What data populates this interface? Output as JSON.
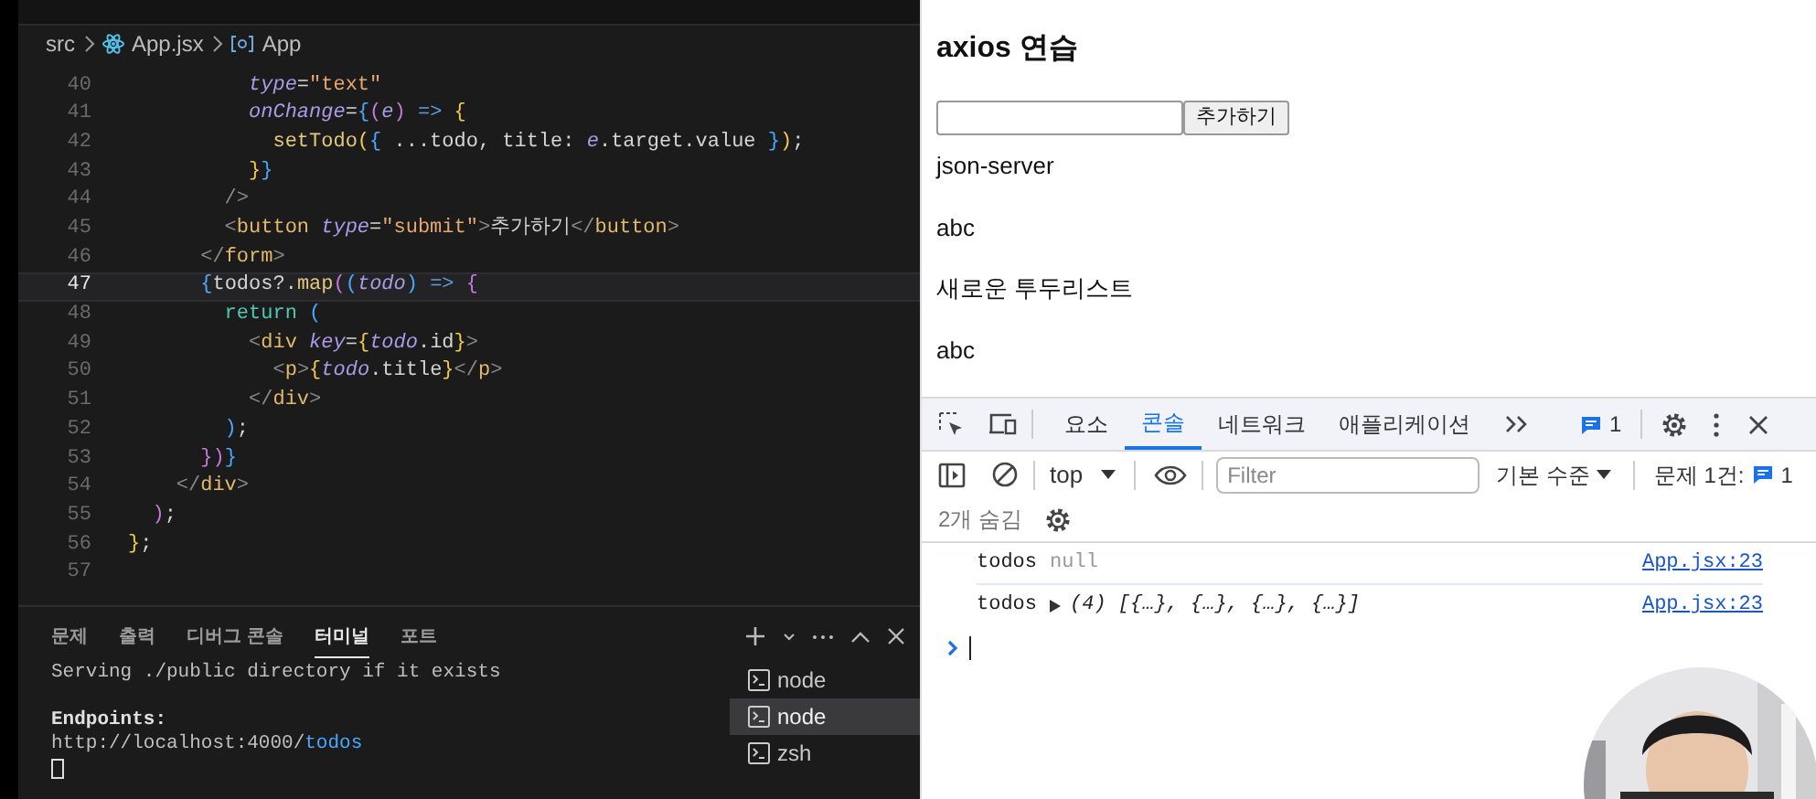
{
  "editor": {
    "breadcrumb": [
      "src",
      "App.jsx",
      "App"
    ],
    "lines": [
      {
        "num": "40",
        "current": false,
        "tokens": [
          {
            "text": "          type",
            "kind": "attr"
          },
          {
            "text": "=",
            "kind": "plain"
          },
          {
            "text": "\"text\"",
            "kind": "str"
          }
        ]
      },
      {
        "num": "41",
        "current": false,
        "tokens": [
          {
            "text": "          onChange",
            "kind": "attr"
          },
          {
            "text": "=",
            "kind": "plain"
          },
          {
            "text": "{",
            "kind": "b3"
          },
          {
            "text": "(",
            "kind": "b2"
          },
          {
            "text": "e",
            "kind": "param"
          },
          {
            "text": ")",
            "kind": "b2"
          },
          {
            "text": " => ",
            "kind": "kw"
          },
          {
            "text": "{",
            "kind": "b1"
          }
        ]
      },
      {
        "num": "42",
        "current": false,
        "tokens": [
          {
            "text": "            setTodo",
            "kind": "fn"
          },
          {
            "text": "(",
            "kind": "b1"
          },
          {
            "text": "{",
            "kind": "b3"
          },
          {
            "text": " ...todo, title: ",
            "kind": "plain"
          },
          {
            "text": "e",
            "kind": "param"
          },
          {
            "text": ".target.value ",
            "kind": "plain"
          },
          {
            "text": "}",
            "kind": "b3"
          },
          {
            "text": ")",
            "kind": "b1"
          },
          {
            "text": ";",
            "kind": "plain"
          }
        ]
      },
      {
        "num": "43",
        "current": false,
        "tokens": [
          {
            "text": "          }",
            "kind": "b1"
          },
          {
            "text": "}",
            "kind": "b3"
          }
        ]
      },
      {
        "num": "44",
        "current": false,
        "tokens": [
          {
            "text": "        />",
            "kind": "tagp"
          }
        ]
      },
      {
        "num": "45",
        "current": false,
        "tokens": [
          {
            "text": "        <",
            "kind": "tagp"
          },
          {
            "text": "button",
            "kind": "tag"
          },
          {
            "text": " type",
            "kind": "attr"
          },
          {
            "text": "=",
            "kind": "plain"
          },
          {
            "text": "\"submit\"",
            "kind": "str"
          },
          {
            "text": ">",
            "kind": "tagp"
          },
          {
            "text": "추가하기",
            "kind": "plain"
          },
          {
            "text": "</",
            "kind": "tagp"
          },
          {
            "text": "button",
            "kind": "tag"
          },
          {
            "text": ">",
            "kind": "tagp"
          }
        ]
      },
      {
        "num": "46",
        "current": false,
        "tokens": [
          {
            "text": "      </",
            "kind": "tagp"
          },
          {
            "text": "form",
            "kind": "tag"
          },
          {
            "text": ">",
            "kind": "tagp"
          }
        ]
      },
      {
        "num": "47",
        "current": true,
        "tokens": [
          {
            "text": "      {",
            "kind": "b3"
          },
          {
            "text": "todos?.",
            "kind": "plain"
          },
          {
            "text": "map",
            "kind": "fn"
          },
          {
            "text": "(",
            "kind": "b2"
          },
          {
            "text": "(",
            "kind": "b3"
          },
          {
            "text": "todo",
            "kind": "param"
          },
          {
            "text": ")",
            "kind": "b3"
          },
          {
            "text": " => ",
            "kind": "kw"
          },
          {
            "text": "{",
            "kind": "b2"
          }
        ]
      },
      {
        "num": "48",
        "current": false,
        "tokens": [
          {
            "text": "        return",
            "kind": "kw2"
          },
          {
            "text": " (",
            "kind": "b3"
          }
        ]
      },
      {
        "num": "49",
        "current": false,
        "tokens": [
          {
            "text": "          <",
            "kind": "tagp"
          },
          {
            "text": "div",
            "kind": "tag"
          },
          {
            "text": " key",
            "kind": "attr"
          },
          {
            "text": "=",
            "kind": "plain"
          },
          {
            "text": "{",
            "kind": "b1"
          },
          {
            "text": "todo",
            "kind": "param"
          },
          {
            "text": ".id",
            "kind": "plain"
          },
          {
            "text": "}",
            "kind": "b1"
          },
          {
            "text": ">",
            "kind": "tagp"
          }
        ]
      },
      {
        "num": "50",
        "current": false,
        "tokens": [
          {
            "text": "            <",
            "kind": "tagp"
          },
          {
            "text": "p",
            "kind": "tag"
          },
          {
            "text": ">",
            "kind": "tagp"
          },
          {
            "text": "{",
            "kind": "b1"
          },
          {
            "text": "todo",
            "kind": "param"
          },
          {
            "text": ".title",
            "kind": "plain"
          },
          {
            "text": "}",
            "kind": "b1"
          },
          {
            "text": "</",
            "kind": "tagp"
          },
          {
            "text": "p",
            "kind": "tag"
          },
          {
            "text": ">",
            "kind": "tagp"
          }
        ]
      },
      {
        "num": "51",
        "current": false,
        "tokens": [
          {
            "text": "          </",
            "kind": "tagp"
          },
          {
            "text": "div",
            "kind": "tag"
          },
          {
            "text": ">",
            "kind": "tagp"
          }
        ]
      },
      {
        "num": "52",
        "current": false,
        "tokens": [
          {
            "text": "        )",
            "kind": "b3"
          },
          {
            "text": ";",
            "kind": "plain"
          }
        ]
      },
      {
        "num": "53",
        "current": false,
        "tokens": [
          {
            "text": "      }",
            "kind": "b2"
          },
          {
            "text": ")",
            "kind": "b2"
          },
          {
            "text": "}",
            "kind": "b3"
          }
        ]
      },
      {
        "num": "54",
        "current": false,
        "tokens": [
          {
            "text": "    </",
            "kind": "tagp"
          },
          {
            "text": "div",
            "kind": "tag"
          },
          {
            "text": ">",
            "kind": "tagp"
          }
        ]
      },
      {
        "num": "55",
        "current": false,
        "tokens": [
          {
            "text": "  )",
            "kind": "b2"
          },
          {
            "text": ";",
            "kind": "plain"
          }
        ]
      },
      {
        "num": "56",
        "current": false,
        "tokens": [
          {
            "text": "}",
            "kind": "b1"
          },
          {
            "text": ";",
            "kind": "plain"
          }
        ]
      },
      {
        "num": "57",
        "current": false
      }
    ]
  },
  "panel": {
    "tabs": [
      {
        "label": "문제",
        "selected": false
      },
      {
        "label": "출력",
        "selected": false
      },
      {
        "label": "디버그 콘솔",
        "selected": false
      },
      {
        "label": "터미널",
        "selected": true
      },
      {
        "label": "포트",
        "selected": false
      }
    ],
    "terminal_lines": [
      [
        {
          "text": "Serving ./public directory if it exists",
          "kind": "plain"
        }
      ],
      [
        {
          "text": "Endpoints:",
          "kind": "bold"
        }
      ],
      [
        {
          "text": "http://localhost:4000/",
          "kind": "plain"
        },
        {
          "text": "todos",
          "kind": "link"
        }
      ]
    ],
    "terminals": [
      {
        "label": "node",
        "selected": false
      },
      {
        "label": "node",
        "selected": true
      },
      {
        "label": "zsh",
        "selected": false
      }
    ]
  },
  "browser": {
    "heading": "axios 연습",
    "button": "추가하기",
    "items": [
      "json-server",
      "abc",
      "새로운 투두리스트",
      "abc"
    ]
  },
  "devtools": {
    "tabs": [
      {
        "label": "요소",
        "selected": false
      },
      {
        "label": "콘솔",
        "selected": true
      },
      {
        "label": "네트워크",
        "selected": false
      },
      {
        "label": "애플리케이션",
        "selected": false
      }
    ],
    "issues_badge": "1",
    "context": "top",
    "filter_placeholder": "Filter",
    "level": "기본 수준",
    "issues_label": "문제 1건:",
    "issues_count": "1",
    "hidden": "2개 숨김",
    "messages": [
      {
        "label": "todos",
        "kind": "null",
        "value": "null",
        "source": "App.jsx:23"
      },
      {
        "label": "todos",
        "kind": "array",
        "value": "(4) [{…}, {…}, {…}, {…}]",
        "source": "App.jsx:23"
      }
    ]
  }
}
